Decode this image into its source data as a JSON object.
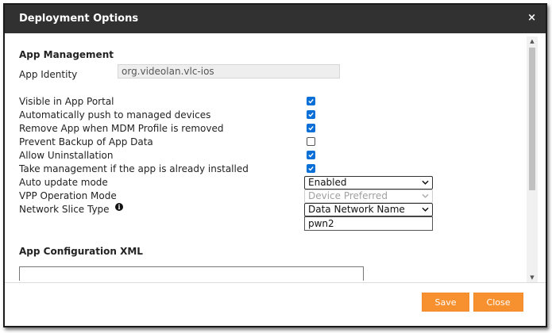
{
  "dialog": {
    "title": "Deployment Options",
    "close_glyph": "×"
  },
  "app_management": {
    "heading": "App Management",
    "identity_label": "App Identity",
    "identity_value": "org.videolan.vlc-ios",
    "options": [
      {
        "label": "Visible in App Portal",
        "checked": true
      },
      {
        "label": "Automatically push to managed devices",
        "checked": true
      },
      {
        "label": "Remove App when MDM Profile is removed",
        "checked": true
      },
      {
        "label": "Prevent Backup of App Data",
        "checked": false
      },
      {
        "label": "Allow Uninstallation",
        "checked": true
      },
      {
        "label": "Take management if the app is already installed",
        "checked": true
      }
    ],
    "auto_update": {
      "label": "Auto update mode",
      "value": "Enabled"
    },
    "vpp_mode": {
      "label": "VPP Operation Mode",
      "value": "Device Preferred",
      "disabled": true
    },
    "network_slice": {
      "label": "Network Slice Type",
      "info_icon": "info-icon",
      "value": "Data Network Name",
      "text_value": "pwn2"
    }
  },
  "app_configuration": {
    "heading": "App Configuration XML",
    "xml_value": ""
  },
  "footer": {
    "save_label": "Save",
    "close_label": "Close"
  },
  "colors": {
    "titlebar": "#313131",
    "accent_button": "#f7902f",
    "checkbox_checked": "#0b6fd8"
  }
}
